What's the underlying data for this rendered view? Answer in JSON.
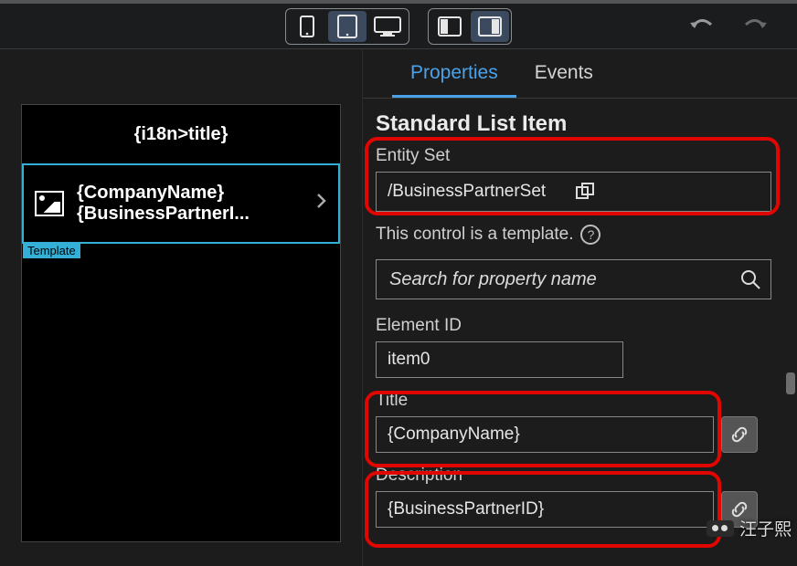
{
  "toolbar": {
    "devices": [
      "phone",
      "tablet",
      "desktop"
    ],
    "active_device": "tablet",
    "orientations": [
      "portrait",
      "landscape"
    ],
    "active_orientation": "landscape"
  },
  "canvas": {
    "header_title": "{i18n>title}",
    "list_item": {
      "title": "{CompanyName}",
      "description": "{BusinessPartnerI...",
      "template_tag": "Template"
    }
  },
  "panel": {
    "tabs": {
      "properties": "Properties",
      "events": "Events",
      "active": "properties"
    },
    "section_title": "Standard List Item",
    "entity_set": {
      "label": "Entity Set",
      "value": "/BusinessPartnerSet"
    },
    "template_hint": "This control is a template.",
    "search_placeholder": "Search for property name",
    "element_id": {
      "label": "Element ID",
      "value": "item0"
    },
    "title": {
      "label": "Title",
      "value": "{CompanyName}"
    },
    "description": {
      "label": "Description",
      "value": "{BusinessPartnerID}"
    }
  },
  "watermark": "汪子熙"
}
